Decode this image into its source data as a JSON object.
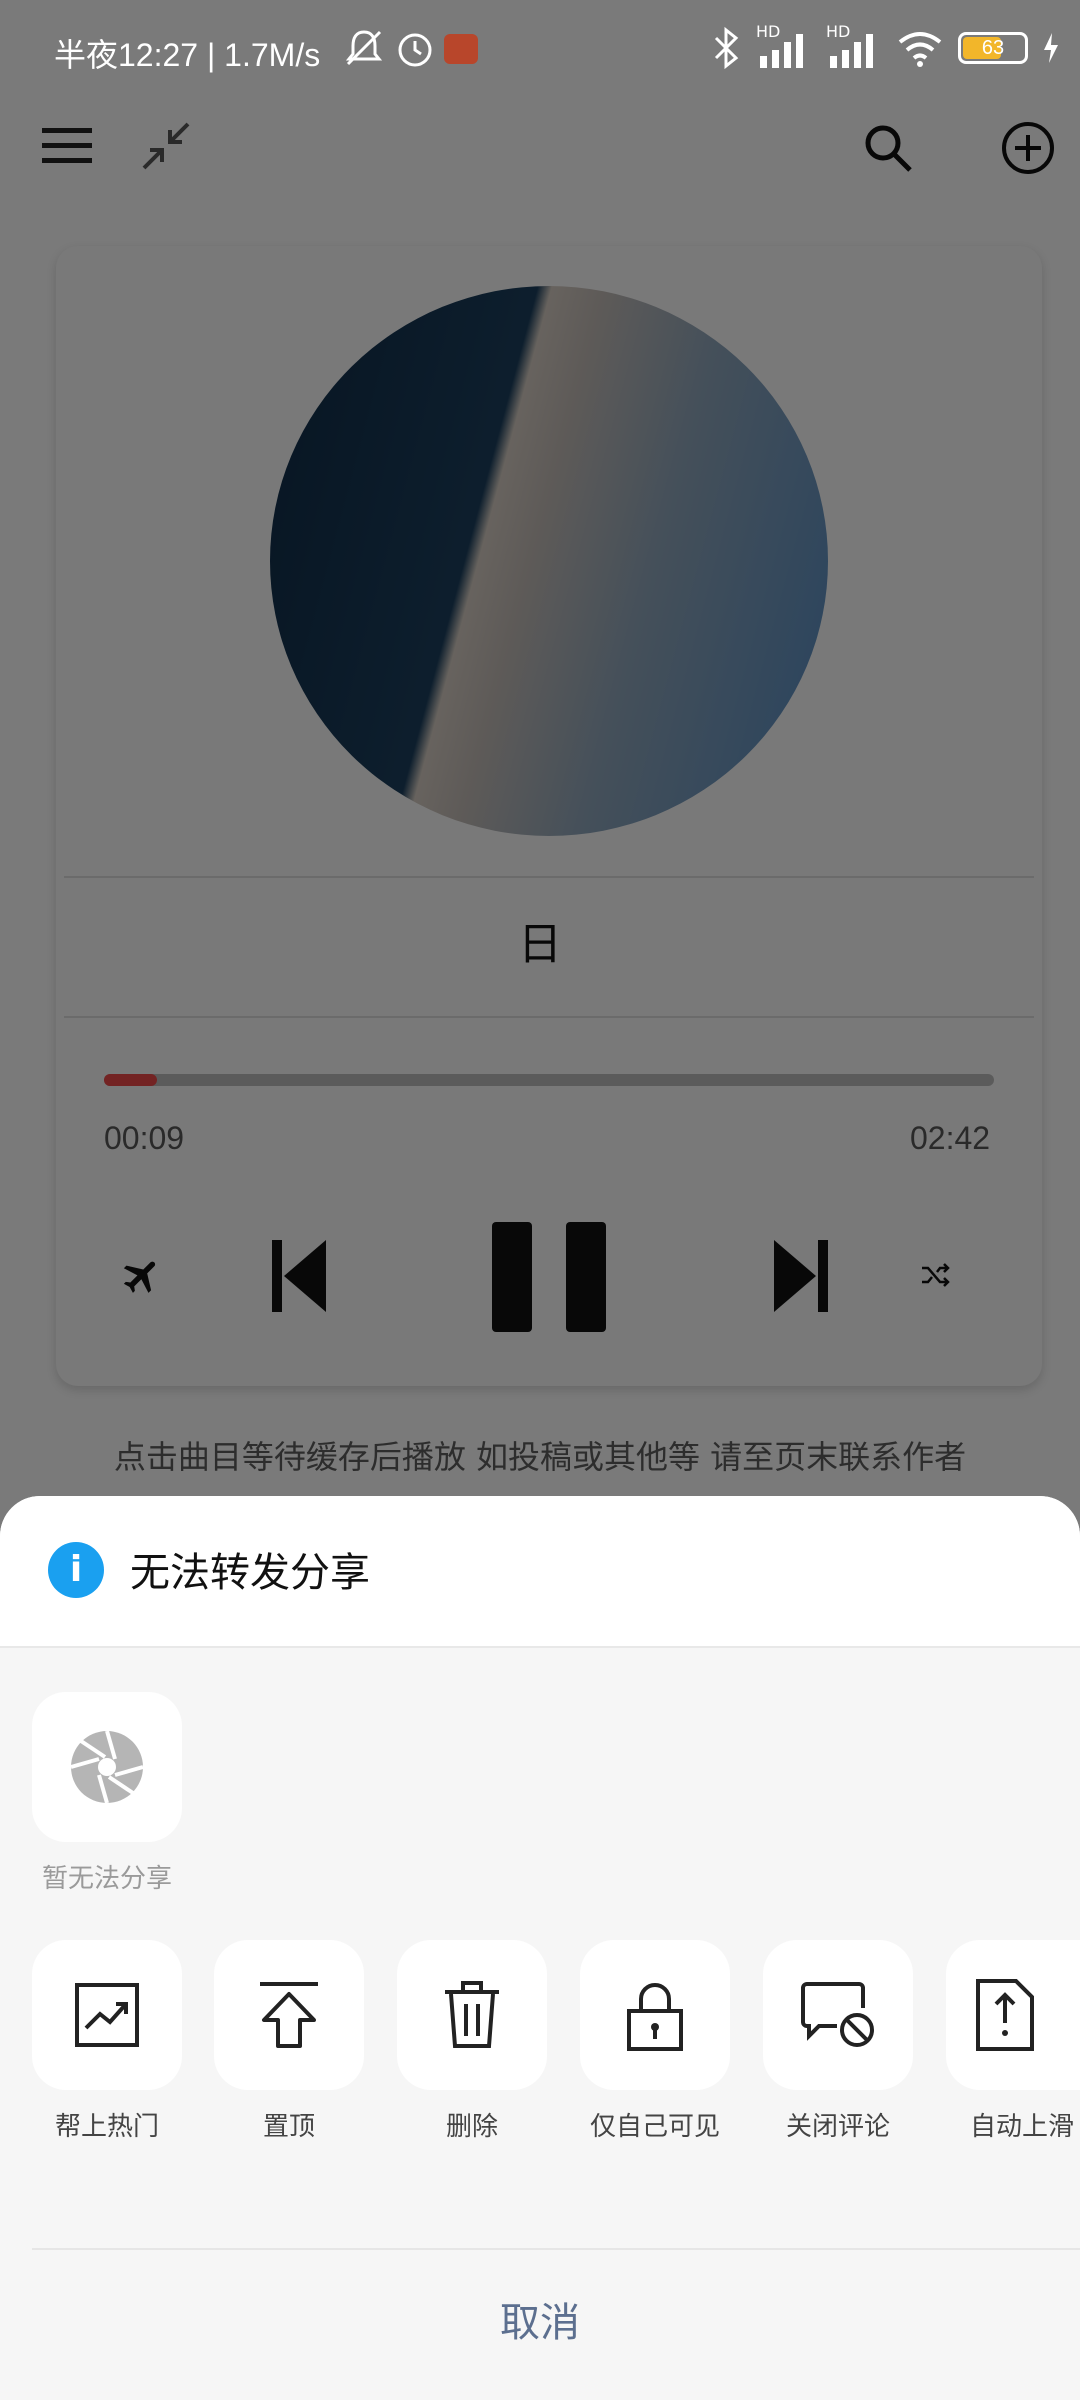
{
  "status_bar": {
    "time_and_speed": "半夜12:27 | 1.7M/s",
    "battery": "63",
    "network_label_1": "HD",
    "network_label_2": "HD"
  },
  "player": {
    "song_title": "日",
    "current_time": "00:09",
    "total_time": "02:42",
    "progress_fraction": 0.06,
    "notice": "点击曲目等待缓存后播放 如投稿或其他等 请至页末联系作者"
  },
  "sheet": {
    "title": "无法转发分享",
    "share_tile_label": "暂无法分享",
    "actions": [
      {
        "label": "帮上热门",
        "icon": "trending-up-icon"
      },
      {
        "label": "置顶",
        "icon": "pin-top-icon"
      },
      {
        "label": "删除",
        "icon": "trash-icon"
      },
      {
        "label": "仅自己可见",
        "icon": "lock-icon"
      },
      {
        "label": "关闭评论",
        "icon": "comment-off-icon"
      },
      {
        "label": "自动上滑",
        "icon": "auto-scroll-up-icon"
      }
    ],
    "cancel_label": "取消"
  },
  "colors": {
    "accent_info": "#1aa0f0",
    "progress": "#e64646",
    "cancel_text": "#5c6f8f"
  }
}
